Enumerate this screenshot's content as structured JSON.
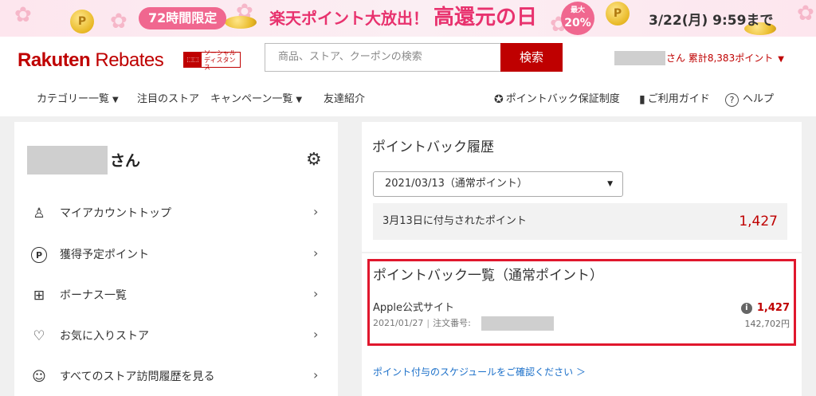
{
  "banner": {
    "pill": "72時間限定",
    "headline": "楽天ポイント大放出！",
    "headline_big": "高還元の日",
    "badge_top": "最大",
    "badge_value": "20%",
    "deadline": "3/22(月) 9:59まで",
    "coin_letter": "P"
  },
  "header": {
    "logo_brand": "Rakuten",
    "logo_product": "Rebates",
    "sd_badge_text": "ソーシャル ディスタンス",
    "search_placeholder": "商品、ストア、クーポンの検索",
    "search_button": "検索",
    "user_suffix": "さん",
    "user_points": "累計8,383ポイント"
  },
  "nav": {
    "categories": "カテゴリー一覧",
    "featured_stores": "注目のストア",
    "campaigns": "キャンペーン一覧",
    "referral": "友達紹介",
    "guarantee": "ポイントバック保証制度",
    "guide": "ご利用ガイド",
    "help": "ヘルプ"
  },
  "sidebar": {
    "name_suffix": "さん",
    "items": [
      {
        "label": "マイアカウントトップ",
        "icon": "person-icon"
      },
      {
        "label": "獲得予定ポイント",
        "icon": "points-icon"
      },
      {
        "label": "ボーナス一覧",
        "icon": "gift-icon"
      },
      {
        "label": "お気に入りストア",
        "icon": "heart-icon"
      },
      {
        "label": "すべてのストア訪問履歴を見る",
        "icon": "history-icon"
      }
    ]
  },
  "history": {
    "title": "ポイントバック履歴",
    "selected_date": "2021/03/13（通常ポイント）",
    "summary_label": "3月13日に付与されたポイント",
    "summary_value": "1,427"
  },
  "pointback_list": {
    "title": "ポイントバック一覧（通常ポイント）",
    "items": [
      {
        "store": "Apple公式サイト",
        "date": "2021/01/27",
        "order_label": "注文番号:",
        "points": "1,427",
        "price": "142,702円"
      }
    ]
  },
  "footer_link": "ポイント付与のスケジュールをご確認ください ＞",
  "colors": {
    "brand_red": "#bf0000",
    "highlight_red": "#e0172d",
    "link_blue": "#1a6fc9",
    "banner_pink": "#f0678f"
  }
}
